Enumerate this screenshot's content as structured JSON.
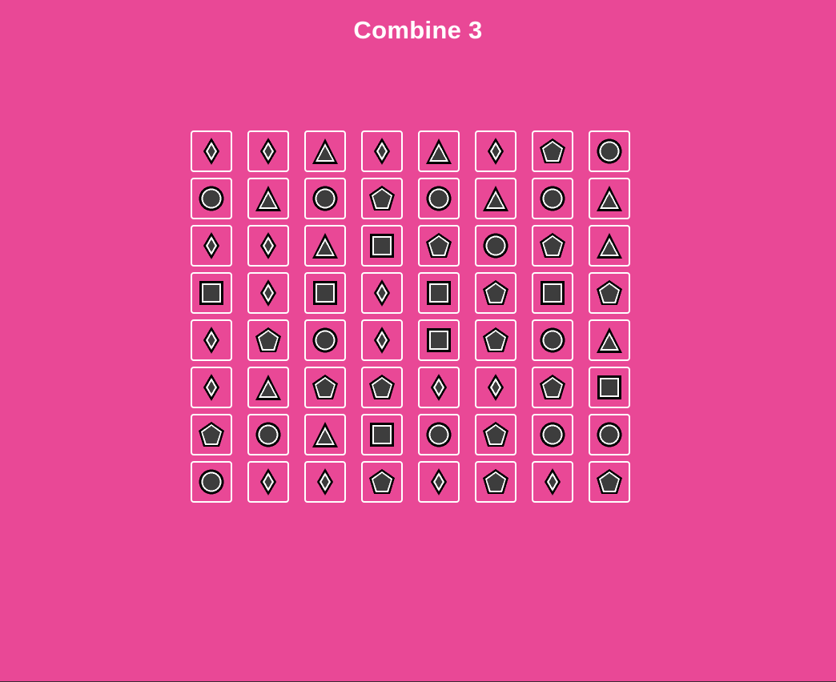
{
  "game": {
    "title": "Combine 3"
  },
  "colors": {
    "background": "#e94896",
    "tile_border": "#ffffff",
    "shape_fill": "#3d3d3d",
    "shape_outline": "#000000",
    "shape_highlight": "#ffffff"
  },
  "board": {
    "rows": 8,
    "cols": 8,
    "grid": [
      [
        "diamond",
        "diamond",
        "triangle",
        "diamond",
        "triangle",
        "diamond",
        "pentagon",
        "circle"
      ],
      [
        "circle",
        "triangle",
        "circle",
        "pentagon",
        "circle",
        "triangle",
        "circle",
        "triangle"
      ],
      [
        "diamond",
        "diamond",
        "triangle",
        "square",
        "pentagon",
        "circle",
        "pentagon",
        "triangle"
      ],
      [
        "square",
        "diamond",
        "square",
        "diamond",
        "square",
        "pentagon",
        "square",
        "pentagon"
      ],
      [
        "diamond",
        "pentagon",
        "circle",
        "diamond",
        "square",
        "pentagon",
        "circle",
        "triangle"
      ],
      [
        "diamond",
        "triangle",
        "pentagon",
        "pentagon",
        "diamond",
        "diamond",
        "pentagon",
        "square"
      ],
      [
        "pentagon",
        "circle",
        "triangle",
        "square",
        "circle",
        "pentagon",
        "circle",
        "circle"
      ],
      [
        "circle",
        "diamond",
        "diamond",
        "pentagon",
        "diamond",
        "pentagon",
        "diamond",
        "pentagon"
      ]
    ]
  }
}
